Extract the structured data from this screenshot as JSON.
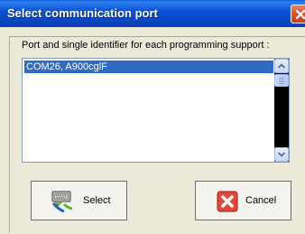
{
  "window": {
    "title": "Select communication port"
  },
  "panel": {
    "label": "Port and single identifier for each programming support :"
  },
  "list": {
    "items": [
      "COM26, A900cglF"
    ],
    "selected_index": 0
  },
  "buttons": {
    "select_label": "Select",
    "cancel_label": "Cancel"
  },
  "icons": {
    "select": "serial-port-device-icon",
    "cancel": "red-x-icon",
    "close": "close-icon"
  },
  "colors": {
    "titlebar": "#0b54d6",
    "selection": "#316ac5",
    "dialog_bg": "#ece9d8",
    "cancel_icon": "#d9342b"
  }
}
